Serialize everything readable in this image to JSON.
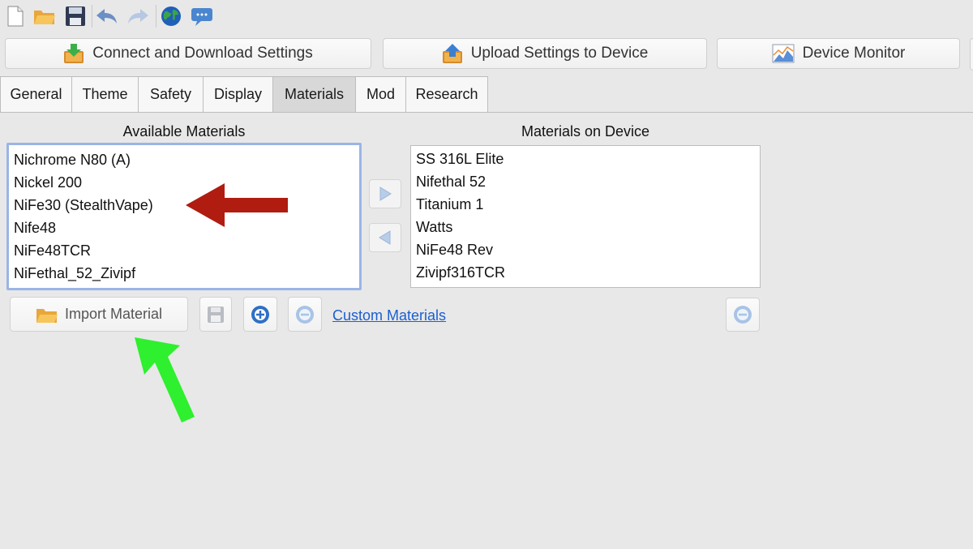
{
  "toolbar": {
    "icons": [
      "new-document-icon",
      "open-folder-icon",
      "save-disk-icon",
      "undo-icon",
      "redo-icon",
      "globe-icon",
      "chat-bubble-icon"
    ]
  },
  "actions": {
    "connect_label": "Connect and Download Settings",
    "upload_label": "Upload Settings to Device",
    "monitor_label": "Device Monitor"
  },
  "tabs": [
    {
      "label": "General",
      "active": false
    },
    {
      "label": "Theme",
      "active": false
    },
    {
      "label": "Safety",
      "active": false
    },
    {
      "label": "Display",
      "active": false
    },
    {
      "label": "Materials",
      "active": true
    },
    {
      "label": "Mod",
      "active": false
    },
    {
      "label": "Research",
      "active": false
    }
  ],
  "available": {
    "title": "Available Materials",
    "items": [
      "Nichrome N80 (A)",
      "Nickel 200",
      "NiFe30 (StealthVape)",
      "Nife48",
      "NiFe48TCR",
      "NiFethal_52_Zivipf"
    ]
  },
  "device": {
    "title": "Materials on Device",
    "items": [
      "SS 316L Elite",
      "Nifethal 52",
      "Titanium 1",
      "Watts",
      "NiFe48 Rev",
      "Zivipf316TCR"
    ]
  },
  "controls": {
    "import_label": "Import Material",
    "custom_link": "Custom Materials"
  },
  "colors": {
    "annotation_red": "#b01c10",
    "annotation_green": "#2ef02e",
    "link_blue": "#1b5fd1",
    "focus_border": "#9ab5e6"
  }
}
